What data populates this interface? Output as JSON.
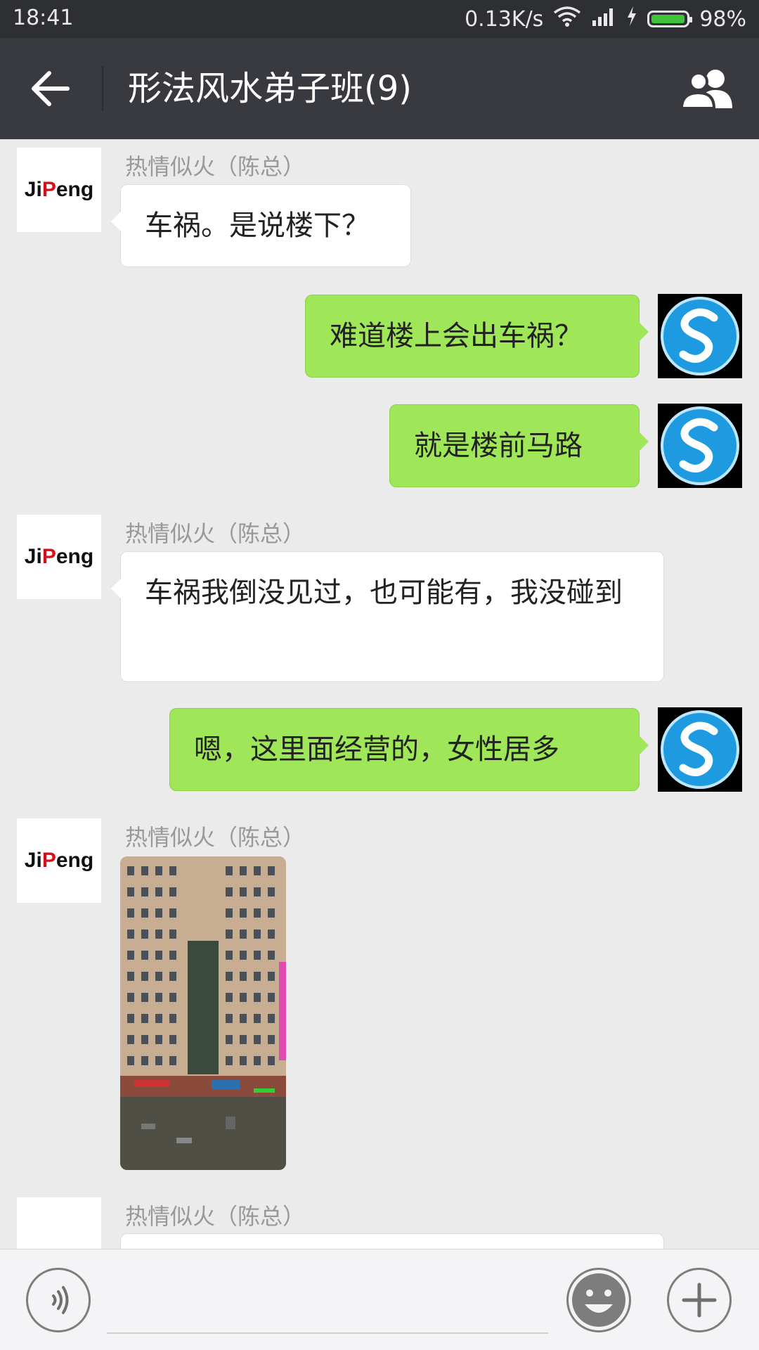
{
  "status_bar": {
    "time": "18:41",
    "net_speed": "0.13K/s",
    "battery_percent": "98%",
    "battery_level": 0.98,
    "icons": [
      "wifi-icon",
      "signal-icon",
      "charging-icon",
      "battery-icon"
    ]
  },
  "header": {
    "title": "形法风水弟子班(9)",
    "back_icon": "arrow-left-icon",
    "members_icon": "group-members-icon"
  },
  "messages": [
    {
      "type": "incoming",
      "sender": "热情似火（陈总）",
      "text": "车祸。是说楼下？",
      "avatar": "JiPeng"
    },
    {
      "type": "outgoing",
      "text": "难道楼上会出车祸？",
      "avatar": "S-logo"
    },
    {
      "type": "outgoing",
      "text": "就是楼前马路",
      "avatar": "S-logo"
    },
    {
      "type": "incoming",
      "sender": "热情似火（陈总）",
      "text": "车祸我倒没见过，也可能有，我没碰到",
      "avatar": "JiPeng"
    },
    {
      "type": "outgoing",
      "text": "嗯，这里面经营的，女性居多",
      "avatar": "S-logo"
    },
    {
      "type": "incoming-image",
      "sender": "热情似火（陈总）",
      "avatar": "JiPeng"
    },
    {
      "type": "incoming",
      "sender": "热情似火（陈总）",
      "text": "",
      "avatar": ""
    }
  ],
  "avatar_logo": {
    "part1": "Ji",
    "part2": "P",
    "part3": "eng"
  },
  "colors": {
    "status_bar": "#2e2f33",
    "title_bar": "#393a3f",
    "chat_bg": "#ebebeb",
    "outgoing_bubble": "#9fe658",
    "incoming_bubble": "#ffffff",
    "battery_fill": "#3fc43a"
  },
  "input_bar": {
    "voice_icon": "voice-icon",
    "emoji_icon": "emoji-icon",
    "plus_icon": "plus-icon"
  }
}
